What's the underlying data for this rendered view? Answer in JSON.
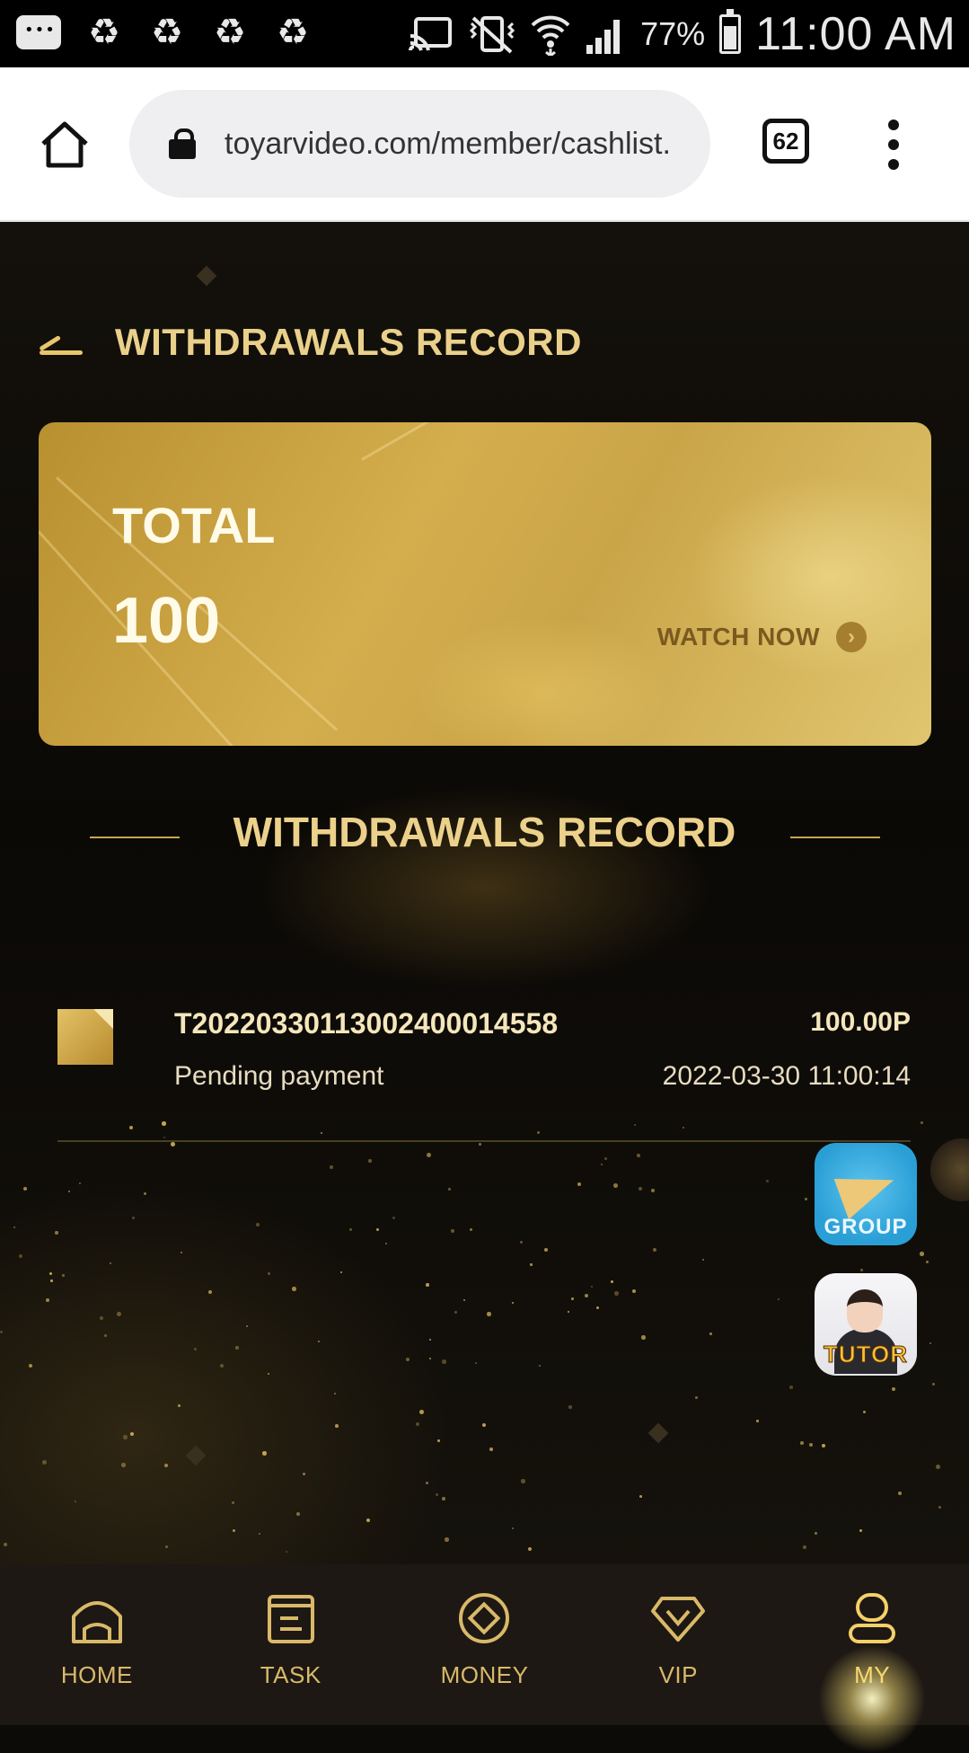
{
  "status_bar": {
    "battery_percent": "77%",
    "battery_level": 0.77,
    "time": "11:00 AM",
    "icons": [
      "messages-icon",
      "recycle-icon",
      "recycle-icon",
      "recycle-icon",
      "recycle-icon",
      "cast-icon",
      "vibrate-mute-icon",
      "wifi-icon",
      "signal-icon",
      "battery-icon"
    ]
  },
  "browser": {
    "url": "toyarvideo.com/member/cashlist.",
    "tab_count": "62"
  },
  "page": {
    "title": "WITHDRAWALS RECORD",
    "card": {
      "label": "TOTAL",
      "value": "100",
      "action": "WATCH NOW"
    },
    "section_title": "WITHDRAWALS RECORD",
    "records": [
      {
        "id": "T20220330113002400014558",
        "status": "Pending payment",
        "amount": "100.00P",
        "time": "2022-03-30 11:00:14"
      }
    ],
    "floating": {
      "group_label": "GROUP",
      "tutor_label": "TUTOR"
    }
  },
  "nav": {
    "items": [
      {
        "label": "HOME",
        "icon": "home-icon"
      },
      {
        "label": "TASK",
        "icon": "task-icon"
      },
      {
        "label": "MONEY",
        "icon": "money-icon"
      },
      {
        "label": "VIP",
        "icon": "vip-diamond-icon"
      },
      {
        "label": "MY",
        "icon": "profile-icon"
      }
    ],
    "active": "MY"
  },
  "colors": {
    "gold_text": "#ead08a",
    "nav_text": "#d9b969",
    "card_gold": "#d4ad4d",
    "background": "#0d0b08"
  }
}
